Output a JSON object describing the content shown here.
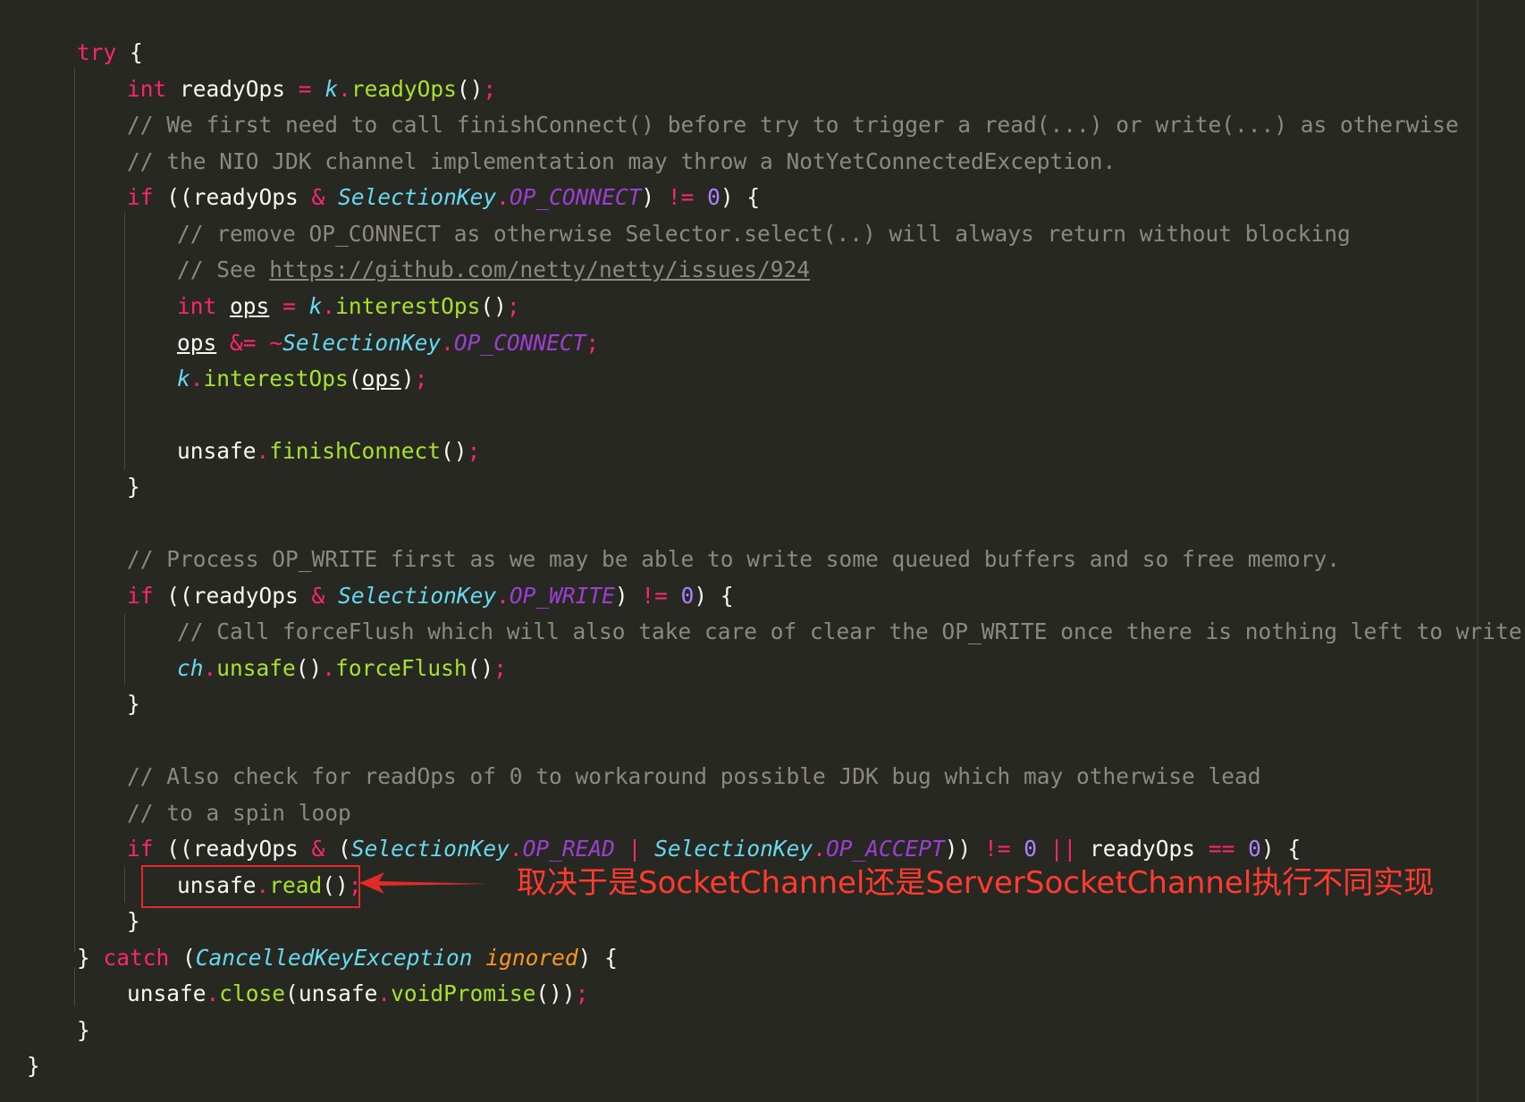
{
  "colors": {
    "background": "#272822",
    "keyword": "#f92672",
    "function": "#a6e22e",
    "class": "#66d9ef",
    "constant": "#9c3fd0",
    "comment": "#8c8a7e",
    "number": "#ae81ff",
    "annotation": "#ff3b30"
  },
  "code": {
    "l1": {
      "kw": "try",
      "rest": " {"
    },
    "l2": {
      "kw": "int",
      "decl": " readyOps ",
      "op": "=",
      "var": "k",
      "dot": ".",
      "fn": "readyOps",
      "paren": "()",
      "semi": ";"
    },
    "l3": "// We first need to call finishConnect() before try to trigger a read(...) or write(...) as otherwise",
    "l4": "// the NIO JDK channel implementation may throw a NotYetConnectedException.",
    "l5": {
      "kw": "if",
      "a": " ((readyOps ",
      "amp": "&",
      "cls": "SelectionKey",
      "dot": ".",
      "const": "OP_CONNECT",
      "b": ") ",
      "neq": "!=",
      "num": "0",
      "c": ") {"
    },
    "l6": "// remove OP_CONNECT as otherwise Selector.select(..) will always return without blocking",
    "l7": {
      "prefix": "// See ",
      "link": "https://github.com/netty/netty/issues/924"
    },
    "l8": {
      "kw": "int",
      "var": "ops",
      "op": "=",
      "k": "k",
      "dot": ".",
      "fn": "interestOps",
      "paren": "()",
      "semi": ";"
    },
    "l9": {
      "var": "ops",
      "op": "&=",
      "tilde": "~",
      "cls": "SelectionKey",
      "dot": ".",
      "const": "OP_CONNECT",
      "semi": ";"
    },
    "l10": {
      "k": "k",
      "dot": ".",
      "fn": "interestOps",
      "open": "(",
      "arg": "ops",
      "close": ")",
      "semi": ";"
    },
    "l11": {
      "obj": "unsafe",
      "dot": ".",
      "fn": "finishConnect",
      "paren": "()",
      "semi": ";"
    },
    "l12": "}",
    "l13": "// Process OP_WRITE first as we may be able to write some queued buffers and so free memory.",
    "l14": {
      "kw": "if",
      "a": " ((readyOps ",
      "amp": "&",
      "cls": "SelectionKey",
      "dot": ".",
      "const": "OP_WRITE",
      "b": ") ",
      "neq": "!=",
      "num": "0",
      "c": ") {"
    },
    "l15": "// Call forceFlush which will also take care of clear the OP_WRITE once there is nothing left to write",
    "l16": {
      "ch": "ch",
      "dot1": ".",
      "fn1": "unsafe",
      "p1": "()",
      "dot2": ".",
      "fn2": "forceFlush",
      "p2": "()",
      "semi": ";"
    },
    "l17": "}",
    "l18": "// Also check for readOps of 0 to workaround possible JDK bug which may otherwise lead",
    "l19": "// to a spin loop",
    "l20": {
      "kw": "if",
      "a": " ((readyOps ",
      "amp": "&",
      "open": " (",
      "cls1": "SelectionKey",
      "dot1": ".",
      "const1": "OP_READ",
      "pipe": "|",
      "cls2": "SelectionKey",
      "dot2": ".",
      "const2": "OP_ACCEPT",
      "b": ")) ",
      "neq": "!=",
      "num1": "0",
      "or": "||",
      "c": " readyOps ",
      "eq": "==",
      "num2": "0",
      "d": ") {"
    },
    "l21": {
      "obj": "unsafe",
      "dot": ".",
      "fn": "read",
      "paren": "()",
      "semi": ";"
    },
    "l22": "}",
    "l23": {
      "close": "} ",
      "kw": "catch",
      "open": " (",
      "cls": "CancelledKeyException",
      "param": "ignored",
      "end": ") {"
    },
    "l24": {
      "obj1": "unsafe",
      "dot1": ".",
      "fn1": "close",
      "open": "(",
      "obj2": "unsafe",
      "dot2": ".",
      "fn2": "voidPromise",
      "close": "())",
      "semi": ";"
    },
    "l25": "}",
    "l26": "}"
  },
  "annotation": {
    "text": "取决于是SocketChannel还是ServerSocketChannel执行不同实现"
  }
}
